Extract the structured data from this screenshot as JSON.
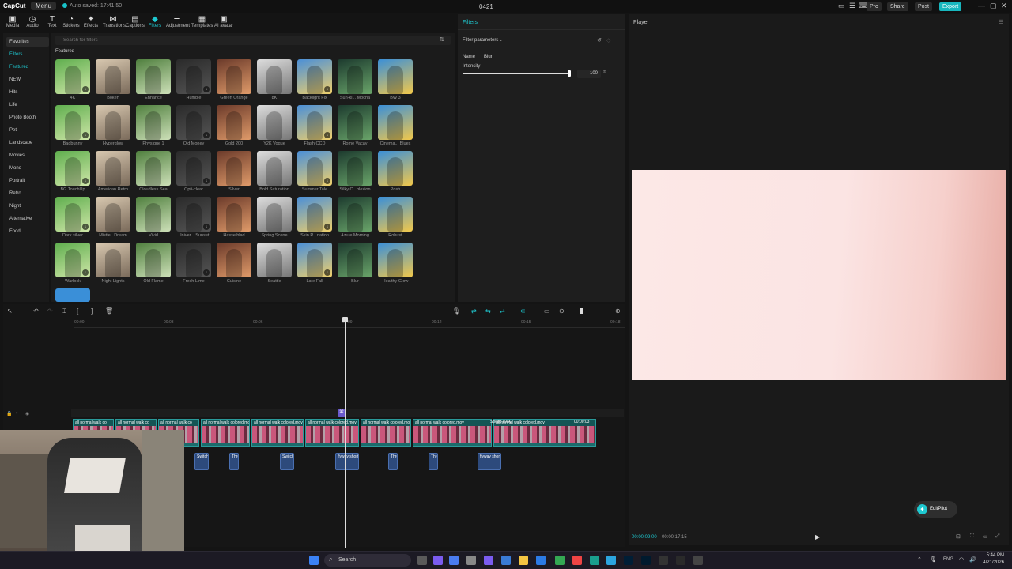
{
  "titlebar": {
    "logo": "CapCut",
    "menu": "Menu",
    "autosave": "Auto saved: 17:41:50",
    "project": "0421",
    "pro": "Pro",
    "share": "Share",
    "post": "Post",
    "export": "Export"
  },
  "toolbar": {
    "media": "Media",
    "audio": "Audio",
    "text": "Text",
    "stickers": "Stickers",
    "effects": "Effects",
    "transitions": "Transitions",
    "captions": "Captions",
    "filters": "Filters",
    "adjustment": "Adjustment",
    "templates": "Templates",
    "ai_avatar": "AI avatar"
  },
  "categories": {
    "favorites": "Favorites",
    "filters": "Filters",
    "featured": "Featured",
    "new": "NEW",
    "hits": "Hits",
    "life": "Life",
    "photo_booth": "Photo Booth",
    "pet": "Pet",
    "landscape": "Landscape",
    "movies": "Movies",
    "mono": "Mono",
    "portrait": "Portrait",
    "retro": "Retro",
    "night": "Night",
    "alternative": "Alternative",
    "food": "Food"
  },
  "browser": {
    "search_placeholder": "Search for filters",
    "section": "Featured"
  },
  "filters": [
    "4K",
    "Bokeh",
    "Enhance",
    "Humble",
    "Green Orange",
    "8K",
    "Backlight Fix",
    "Sun-ki... Mocha",
    "BW 3",
    "Badbunny",
    "Hyperglow",
    "Physique 1",
    "Old Money",
    "Gold 200",
    "Y2K Vogue",
    "Flash CCD",
    "Rome Vacay",
    "Cinema... Blues",
    "BG TouchUp",
    "American Retro",
    "Cloudless Sea",
    "Opti-clear",
    "Silver",
    "Bold Saturation",
    "Summer Tale",
    "Silky C...plexion",
    "Posh",
    "Dark silver",
    "Mistie...Dream",
    "Vivid",
    "Univer... Sunset",
    "Hasselblad",
    "Spring Scene",
    "Skin R...nation",
    "Azure Morning",
    "Robust",
    "Warlock",
    "Night Lights",
    "Old Flame",
    "Fresh Lime",
    "Cuisine",
    "Seattle",
    "Late Fall",
    "Blur",
    "Healthy Glow"
  ],
  "params": {
    "tab": "Filters",
    "section": "Filter parameters",
    "name_label": "Name",
    "name_value": "Blur",
    "intensity_label": "Intensity",
    "intensity_value": "100",
    "intensity_level": 1.0
  },
  "player": {
    "title": "Player",
    "time_current": "00:00:09:00",
    "time_total": "00:00:17:15",
    "editpilot": "EditPilot"
  },
  "timeline": {
    "ticks": [
      "00:00",
      "00:03",
      "00:06",
      "00:09",
      "00:12",
      "00:15",
      "00:18"
    ],
    "clip_label": "all normal walk colored.mov",
    "clip_label_short": "all normal walk co",
    "speed": "Speed 0.6X",
    "end_time": "00:00:03",
    "subs": [
      "Switch",
      "Thro",
      "Switch",
      "flyway short",
      "Thro",
      "Thro",
      "flyway short"
    ]
  },
  "taskbar": {
    "search": "Search",
    "lang": "ENG",
    "time": "5:44 PM",
    "date": "4/21/2026"
  }
}
